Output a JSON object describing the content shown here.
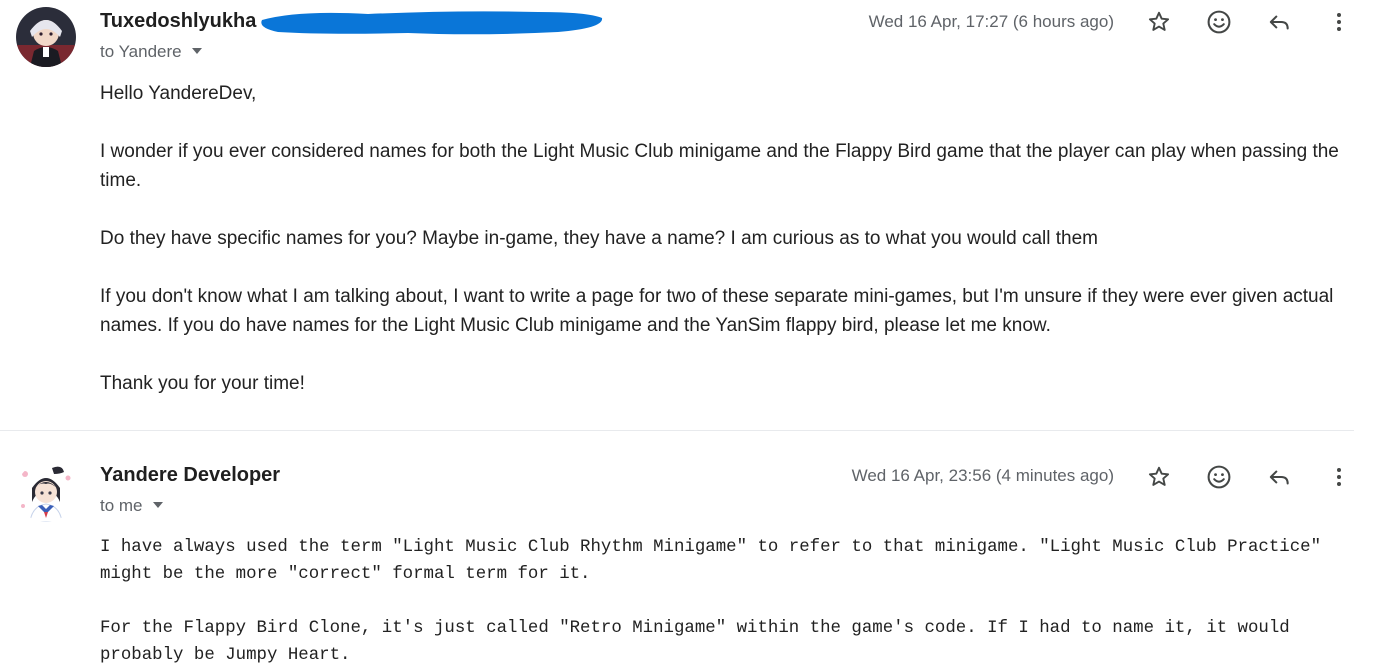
{
  "messages": [
    {
      "sender": "Tuxedoshlyukha",
      "recipient": "to Yandere",
      "timestamp": "Wed 16 Apr, 17:27 (6 hours ago)",
      "paragraphs": [
        "Hello YandereDev,",
        "I wonder if you ever considered names for both the Light Music Club minigame and the Flappy Bird game that the player can play when passing the time.",
        "Do they have specific names for you? Maybe in-game, they have a name? I am curious as to what you would call them",
        "If you don't know what I am talking about, I want to write a page for two of these separate mini-games, but I'm unsure if they were ever given actual names. If you do have names for the Light Music Club minigame and the YanSim flappy bird, please let me know.",
        "Thank you for your time!"
      ],
      "icons": [
        "star-icon",
        "emoji-icon",
        "reply-icon",
        "more-vert-icon"
      ]
    },
    {
      "sender": "Yandere Developer",
      "recipient": "to me",
      "timestamp": "Wed 16 Apr, 23:56 (4 minutes ago)",
      "paragraphs": [
        "I have always used the term \"Light Music Club Rhythm Minigame\" to refer to that minigame. \"Light Music Club Practice\" might be the more \"correct\" formal term for it.",
        "For the Flappy Bird Clone, it's just called \"Retro Minigame\" within the game's code. If I had to name it, it would probably be Jumpy Heart."
      ],
      "icons": [
        "star-icon",
        "emoji-icon",
        "reply-icon",
        "more-vert-icon"
      ]
    }
  ],
  "colors": {
    "redaction": "#0a76d8",
    "icon": "#444746",
    "meta_text": "#5f6368",
    "divider": "#e8eaed"
  }
}
